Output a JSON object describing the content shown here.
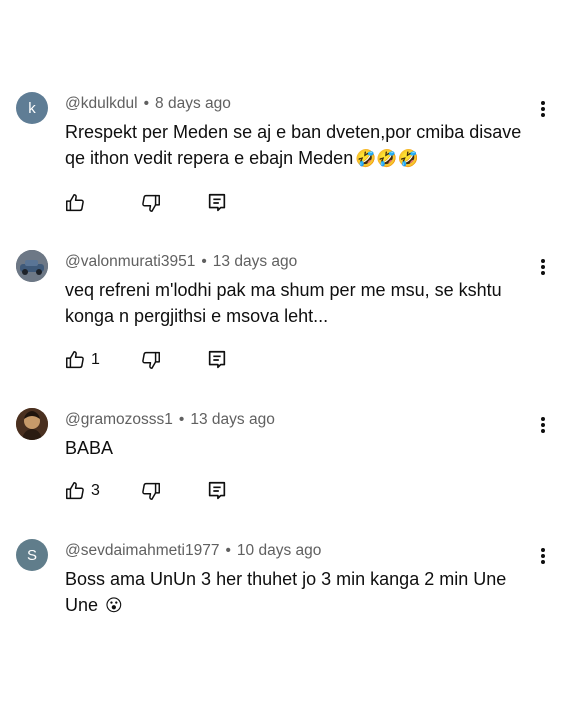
{
  "comments": [
    {
      "avatar_letter": "k",
      "handle": "@kdulkdul",
      "age": "8 days ago",
      "text": "Rrespekt per Meden se aj e ban dveten,por cmiba disave qe ithon vedit repera e ebajn Meden",
      "emoji": "🤣🤣🤣",
      "likes": ""
    },
    {
      "avatar_letter": "",
      "handle": "@valonmurati3951",
      "age": "13 days ago",
      "text": "veq refreni m'lodhi pak ma shum per me msu, se kshtu konga n pergjithsi e msova leht...",
      "emoji": "",
      "likes": "1"
    },
    {
      "avatar_letter": "",
      "handle": "@gramozosss1",
      "age": "13 days ago",
      "text": "BABA",
      "emoji": "",
      "likes": "3"
    },
    {
      "avatar_letter": "S",
      "handle": "@sevdaimahmeti1977",
      "age": "10 days ago",
      "text": "Boss ama UnUn 3 her thuhet jo 3 min kanga 2 min Une Une",
      "emoji": "😮",
      "likes": ""
    }
  ],
  "separator": "•",
  "icons": {
    "like": "thumb-up-icon",
    "dislike": "thumb-down-icon",
    "reply": "reply-comment-icon",
    "more": "more-vert-icon"
  }
}
